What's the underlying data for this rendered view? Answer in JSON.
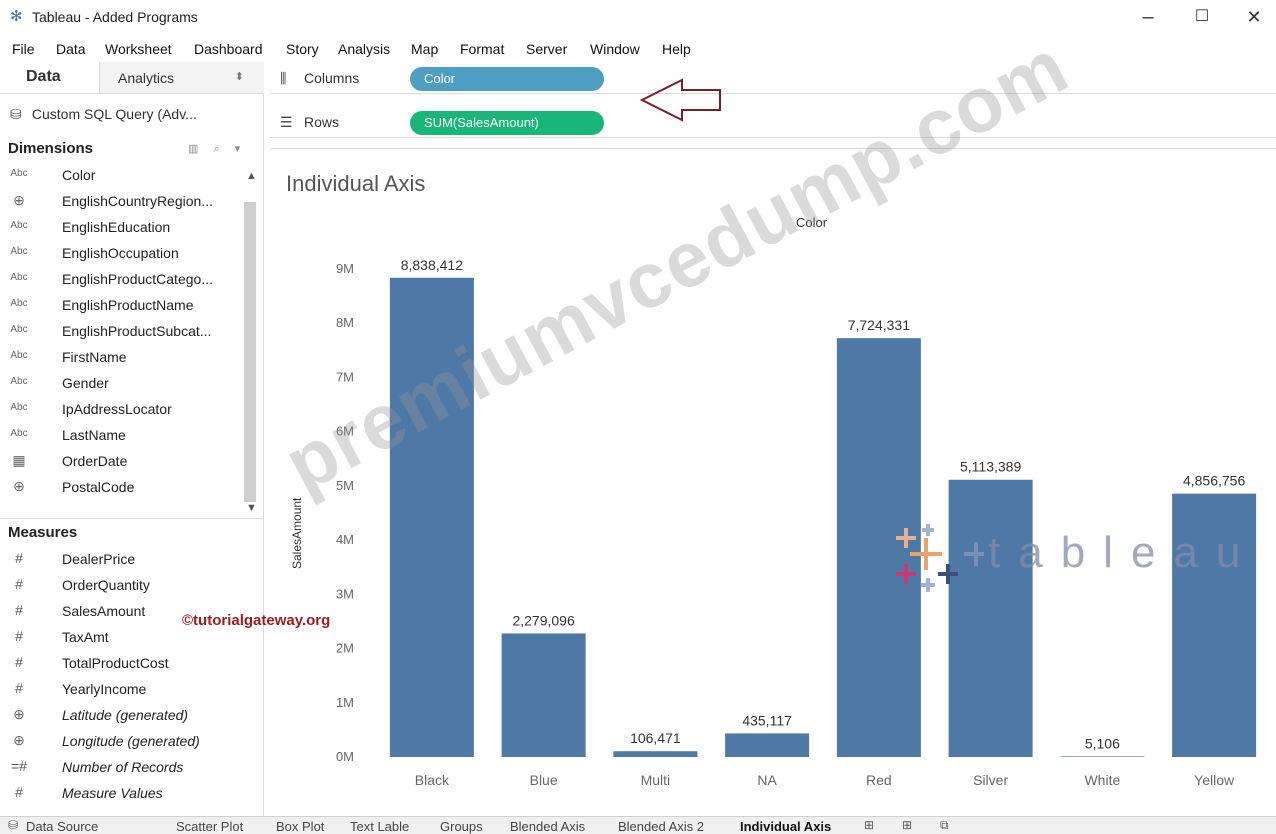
{
  "window": {
    "title": "Tableau - Added Programs",
    "controls": [
      "–",
      "☐",
      "✕"
    ]
  },
  "menu": [
    "File",
    "Data",
    "Worksheet",
    "Dashboard",
    "Story",
    "Analysis",
    "Map",
    "Format",
    "Server",
    "Window",
    "Help"
  ],
  "left_panel": {
    "tab_data": "Data",
    "tab_analytics": "Analytics",
    "datasource": "Custom SQL Query (Adv...",
    "dimensions_title": "Dimensions",
    "dimensions": [
      {
        "icon": "Abc",
        "label": "Color"
      },
      {
        "icon": "globe",
        "label": "EnglishCountryRegion..."
      },
      {
        "icon": "Abc",
        "label": "EnglishEducation"
      },
      {
        "icon": "Abc",
        "label": "EnglishOccupation"
      },
      {
        "icon": "Abc",
        "label": "EnglishProductCatego..."
      },
      {
        "icon": "Abc",
        "label": "EnglishProductName"
      },
      {
        "icon": "Abc",
        "label": "EnglishProductSubcat..."
      },
      {
        "icon": "Abc",
        "label": "FirstName"
      },
      {
        "icon": "Abc",
        "label": "Gender"
      },
      {
        "icon": "Abc",
        "label": "IpAddressLocator"
      },
      {
        "icon": "Abc",
        "label": "LastName"
      },
      {
        "icon": "calendar",
        "label": "OrderDate"
      },
      {
        "icon": "globe",
        "label": "PostalCode"
      }
    ],
    "measures_title": "Measures",
    "measures": [
      {
        "icon": "#",
        "label": "DealerPrice",
        "italic": false
      },
      {
        "icon": "#",
        "label": "OrderQuantity",
        "italic": false
      },
      {
        "icon": "#",
        "label": "SalesAmount",
        "italic": false
      },
      {
        "icon": "#",
        "label": "TaxAmt",
        "italic": false
      },
      {
        "icon": "#",
        "label": "TotalProductCost",
        "italic": false
      },
      {
        "icon": "#",
        "label": "YearlyIncome",
        "italic": false
      },
      {
        "icon": "globe",
        "label": "Latitude (generated)",
        "italic": true
      },
      {
        "icon": "globe",
        "label": "Longitude (generated)",
        "italic": true
      },
      {
        "icon": "=#",
        "label": "Number of Records",
        "italic": true
      },
      {
        "icon": "#",
        "label": "Measure Values",
        "italic": true
      }
    ]
  },
  "shelves": {
    "columns_label": "Columns",
    "columns_pill": "Color",
    "rows_label": "Rows",
    "rows_pill": "SUM(SalesAmount)"
  },
  "sheet": {
    "title": "Individual Axis",
    "column_header": "Color",
    "bar_color": "#4e79a7"
  },
  "chart_data": {
    "type": "bar",
    "title": "Individual Axis",
    "xlabel": "Color",
    "ylabel": "SalesAmount",
    "categories": [
      "Black",
      "Blue",
      "Multi",
      "NA",
      "Red",
      "Silver",
      "White",
      "Yellow"
    ],
    "values": [
      8838412,
      2279096,
      106471,
      435117,
      7724331,
      5113389,
      5106,
      4856756
    ],
    "data_labels": [
      "8,838,412",
      "2,279,096",
      "106,471",
      "435,117",
      "7,724,331",
      "5,113,389",
      "5,106",
      "4,856,756"
    ],
    "yticks": [
      "0M",
      "1M",
      "2M",
      "3M",
      "4M",
      "5M",
      "6M",
      "7M",
      "8M",
      "9M"
    ],
    "ylim": [
      0,
      9000000
    ],
    "grid": false
  },
  "watermarks": {
    "main": "premiumvcedump.com",
    "tutorial": "©tutorialgateway.org",
    "tableau": "tableau"
  },
  "bottom_tabs": [
    {
      "label": "Data Source",
      "active": false
    },
    {
      "label": "Scatter Plot",
      "active": false
    },
    {
      "label": "Box Plot",
      "active": false
    },
    {
      "label": "Text Lable",
      "active": false
    },
    {
      "label": "Groups",
      "active": false
    },
    {
      "label": "Blended Axis",
      "active": false
    },
    {
      "label": "Blended Axis 2",
      "active": false
    },
    {
      "label": "Individual Axis",
      "active": true
    }
  ]
}
